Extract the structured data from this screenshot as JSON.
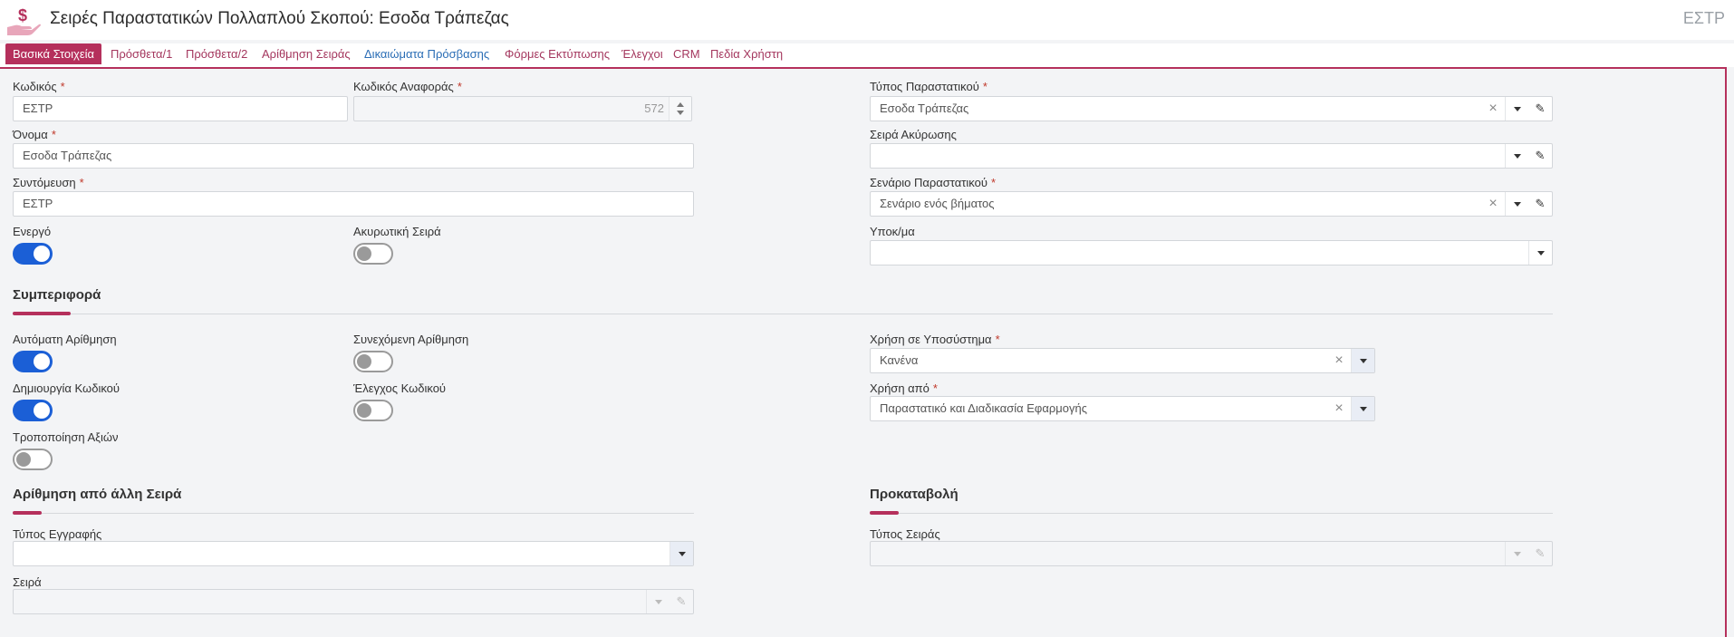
{
  "header": {
    "title": "Σειρές Παραστατικών Πολλαπλού Σκοπού: Εσοδα Τράπεζας",
    "code": "ΕΣΤΡ",
    "logo_icon": "hand-money-icon"
  },
  "tabs": [
    {
      "label": "Βασικά Στοιχεία"
    },
    {
      "label": "Πρόσθετα/1"
    },
    {
      "label": "Πρόσθετα/2"
    },
    {
      "label": "Αρίθμηση Σειράς"
    },
    {
      "label": "Δικαιώματα Πρόσβασης"
    },
    {
      "label": "Φόρμες Εκτύπωσης"
    },
    {
      "label": "Έλεγχοι"
    },
    {
      "label": "CRM"
    },
    {
      "label": "Πεδία Χρήστη"
    }
  ],
  "fields": {
    "code": {
      "label": "Κωδικός",
      "value": "ΕΣΤΡ"
    },
    "ref_code": {
      "label": "Κωδικός Αναφοράς",
      "value": "572"
    },
    "doc_type": {
      "label": "Τύπος Παραστατικού",
      "value": "Εσοδα Τράπεζας"
    },
    "name": {
      "label": "Όνομα",
      "value": "Εσοδα Τράπεζας"
    },
    "cancel_series": {
      "label": "Σειρά Ακύρωσης",
      "value": ""
    },
    "short": {
      "label": "Συντόμευση",
      "value": "ΕΣΤΡ"
    },
    "scenario": {
      "label": "Σενάριο Παραστατικού",
      "value": "Σενάριο ενός βήματος"
    },
    "active": {
      "label": "Ενεργό",
      "on": true
    },
    "cancel_seq": {
      "label": "Ακυρωτική Σειρά",
      "on": false
    },
    "branch": {
      "label": "Υποκ/μα",
      "value": ""
    }
  },
  "behavior": {
    "title": "Συμπεριφορά",
    "auto_num": {
      "label": "Αυτόματη Αρίθμηση",
      "on": true
    },
    "cont_num": {
      "label": "Συνεχόμενη Αρίθμηση",
      "on": false
    },
    "create_code": {
      "label": "Δημιουργία Κωδικού",
      "on": true
    },
    "check_code": {
      "label": "Έλεγχος Κωδικού",
      "on": false
    },
    "modify_values": {
      "label": "Τροποποίηση Αξιών",
      "on": false
    },
    "subsystem": {
      "label": "Χρήση σε Υποσύστημα",
      "value": "Κανένα"
    },
    "used_by": {
      "label": "Χρήση από",
      "value": "Παραστατικό και Διαδικασία Εφαρμογής"
    }
  },
  "other_numbering": {
    "title": "Αρίθμηση από άλλη Σειρά",
    "entry_type": {
      "label": "Τύπος Εγγραφής",
      "value": ""
    },
    "series": {
      "label": "Σειρά",
      "value": ""
    }
  },
  "advance": {
    "title": "Προκαταβολή",
    "series_type": {
      "label": "Τύπος Σειράς",
      "value": ""
    }
  }
}
